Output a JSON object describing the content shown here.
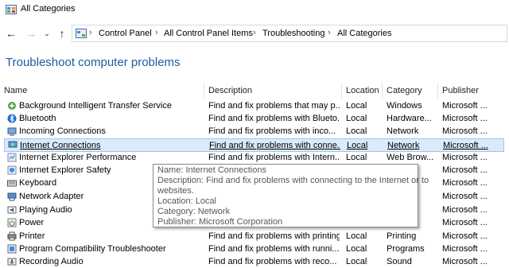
{
  "window": {
    "title": "All Categories",
    "icon": "control-panel-icon"
  },
  "nav": {
    "back_icon": "back-arrow-icon",
    "forward_icon": "forward-arrow-icon",
    "recent_icon": "chevron-down-icon",
    "up_icon": "up-arrow-icon",
    "breadcrumbs": [
      "Control Panel",
      "All Control Panel Items",
      "Troubleshooting",
      "All Categories"
    ],
    "separator": "›"
  },
  "page": {
    "heading": "Troubleshoot computer problems"
  },
  "columns": [
    "Name",
    "Description",
    "Location",
    "Category",
    "Publisher"
  ],
  "rows": [
    {
      "icon": "bits-icon",
      "name": "Background Intelligent Transfer Service",
      "description": "Find and fix problems that may p...",
      "location": "Local",
      "category": "Windows",
      "publisher": "Microsoft ..."
    },
    {
      "icon": "bluetooth-icon",
      "name": "Bluetooth",
      "description": "Find and fix problems with Blueto...",
      "location": "Local",
      "category": "Hardware...",
      "publisher": "Microsoft ..."
    },
    {
      "icon": "incoming-connections-icon",
      "name": "Incoming Connections",
      "description": "Find and fix problems with inco...",
      "location": "Local",
      "category": "Network",
      "publisher": "Microsoft ..."
    },
    {
      "icon": "internet-connections-icon",
      "name": "Internet Connections",
      "description": "Find and fix problems with conne...",
      "location": "Local",
      "category": "Network",
      "publisher": "Microsoft ..."
    },
    {
      "icon": "ie-performance-icon",
      "name": "Internet Explorer Performance",
      "description": "Find and fix problems with Intern...",
      "location": "Local",
      "category": "Web Brow...",
      "publisher": "Microsoft ..."
    },
    {
      "icon": "ie-safety-icon",
      "name": "Internet Explorer Safety",
      "description": "",
      "location": "",
      "category": "",
      "publisher": "Microsoft ..."
    },
    {
      "icon": "keyboard-icon",
      "name": "Keyboard",
      "description": "",
      "location": "",
      "category": "",
      "publisher": "Microsoft ..."
    },
    {
      "icon": "network-adapter-icon",
      "name": "Network Adapter",
      "description": "",
      "location": "",
      "category": "",
      "publisher": "Microsoft ..."
    },
    {
      "icon": "playing-audio-icon",
      "name": "Playing Audio",
      "description": "",
      "location": "",
      "category": "",
      "publisher": "Microsoft ..."
    },
    {
      "icon": "power-icon",
      "name": "Power",
      "description": "",
      "location": "",
      "category": "",
      "publisher": "Microsoft ..."
    },
    {
      "icon": "printer-icon",
      "name": "Printer",
      "description": "Find and fix problems with printing",
      "location": "Local",
      "category": "Printing",
      "publisher": "Microsoft ..."
    },
    {
      "icon": "compatibility-icon",
      "name": "Program Compatibility Troubleshooter",
      "description": "Find and fix problems with runni...",
      "location": "Local",
      "category": "Programs",
      "publisher": "Microsoft ..."
    },
    {
      "icon": "recording-audio-icon",
      "name": "Recording Audio",
      "description": "Find and fix problems with reco...",
      "location": "Local",
      "category": "Sound",
      "publisher": "Microsoft ..."
    }
  ],
  "selected_row": "Internet Connections",
  "tooltip": {
    "lines": [
      "Name: Internet Connections",
      "Description: Find and fix problems with connecting to the Internet or to",
      "websites.",
      "Location: Local",
      "Category: Network",
      "Publisher: Microsoft Corporation"
    ]
  },
  "colors": {
    "heading": "#1e5aa0",
    "selection_bg": "#dbeaf9",
    "selection_border": "#9ac6ee"
  }
}
